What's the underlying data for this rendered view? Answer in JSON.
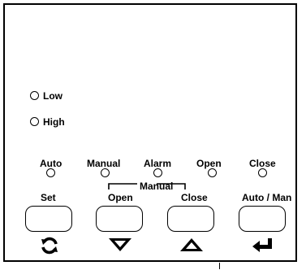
{
  "level_indicators": [
    {
      "label": "Low"
    },
    {
      "label": "High"
    }
  ],
  "status_indicators": [
    {
      "label": "Auto"
    },
    {
      "label": "Manual"
    },
    {
      "label": "Alarm"
    },
    {
      "label": "Open"
    },
    {
      "label": "Close"
    }
  ],
  "manual_group_label": "Manual",
  "buttons": [
    {
      "label": "Set",
      "icon": "refresh-icon"
    },
    {
      "label": "Open",
      "icon": "down-arrow-icon"
    },
    {
      "label": "Close",
      "icon": "up-arrow-icon"
    },
    {
      "label": "Auto / Man",
      "icon": "enter-icon"
    }
  ]
}
